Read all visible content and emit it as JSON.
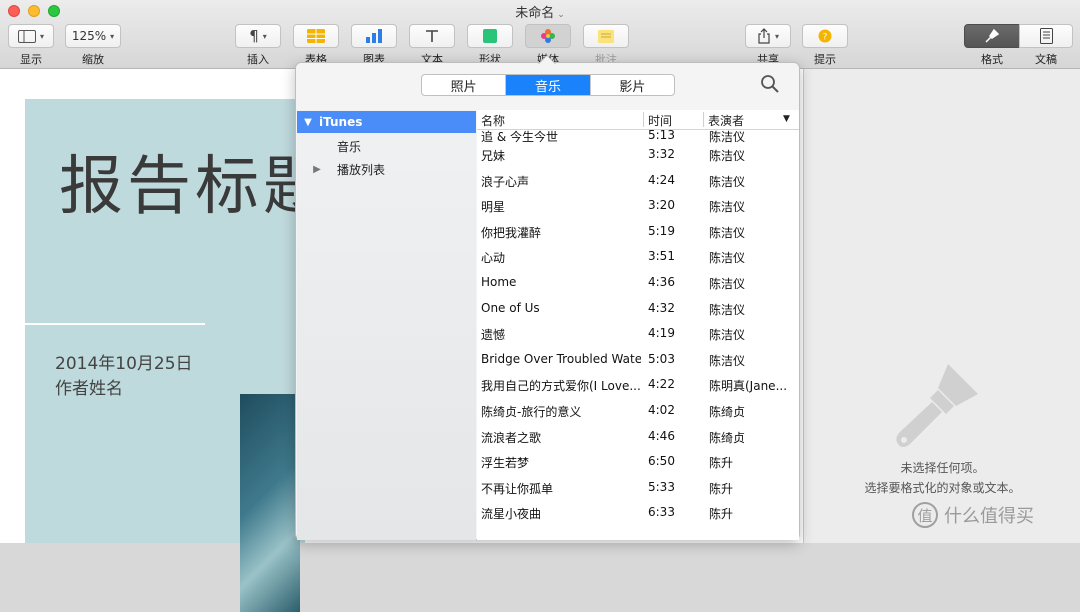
{
  "window": {
    "title": "未命名"
  },
  "toolbar": {
    "view_label": "显示",
    "zoom_value": "125%",
    "zoom_label": "缩放",
    "insert_label": "插入",
    "table_label": "表格",
    "chart_label": "图表",
    "text_label": "文本",
    "shape_label": "形状",
    "media_label": "媒体",
    "comment_label": "批注",
    "share_label": "共享",
    "tips_label": "提示",
    "format_label": "格式",
    "document_label": "文稿"
  },
  "colors": {
    "accent": "#1a82fb",
    "sidebar_selected": "#4b8df8",
    "page_bg": "#bfdadd"
  },
  "document": {
    "title": "报告标题",
    "date": "2014年10月25日",
    "author": "作者姓名"
  },
  "inspector": {
    "line1": "未选择任何项。",
    "line2": "选择要格式化的对象或文本。"
  },
  "watermark": {
    "text": "什么值得买",
    "glyph": "值"
  },
  "media_browser": {
    "tabs": [
      "照片",
      "音乐",
      "影片"
    ],
    "active_tab": "音乐",
    "sidebar": {
      "root": "iTunes",
      "music": "音乐",
      "playlists": "播放列表"
    },
    "columns": {
      "name": "名称",
      "time": "时间",
      "artist": "表演者"
    },
    "songs": [
      {
        "name": "追 & 今生今世",
        "time": "5:13",
        "artist": "陈洁仪"
      },
      {
        "name": "兄妹",
        "time": "3:32",
        "artist": "陈洁仪"
      },
      {
        "name": "浪子心声",
        "time": "4:24",
        "artist": "陈洁仪"
      },
      {
        "name": "明星",
        "time": "3:20",
        "artist": "陈洁仪"
      },
      {
        "name": "你把我灌醉",
        "time": "5:19",
        "artist": "陈洁仪"
      },
      {
        "name": "心动",
        "time": "3:51",
        "artist": "陈洁仪"
      },
      {
        "name": "Home",
        "time": "4:36",
        "artist": "陈洁仪"
      },
      {
        "name": "One of Us",
        "time": "4:32",
        "artist": "陈洁仪"
      },
      {
        "name": "遗憾",
        "time": "4:19",
        "artist": "陈洁仪"
      },
      {
        "name": "Bridge Over Troubled Water",
        "time": "5:03",
        "artist": "陈洁仪"
      },
      {
        "name": "我用自己的方式爱你(I Love...",
        "time": "4:22",
        "artist": "陈明真(Jane..."
      },
      {
        "name": "陈绮贞-旅行的意义",
        "time": "4:02",
        "artist": "陈绮贞"
      },
      {
        "name": "流浪者之歌",
        "time": "4:46",
        "artist": "陈绮贞"
      },
      {
        "name": "浮生若梦",
        "time": "6:50",
        "artist": "陈升"
      },
      {
        "name": "不再让你孤单",
        "time": "5:33",
        "artist": "陈升"
      },
      {
        "name": "流星小夜曲",
        "time": "6:33",
        "artist": "陈升"
      }
    ]
  }
}
